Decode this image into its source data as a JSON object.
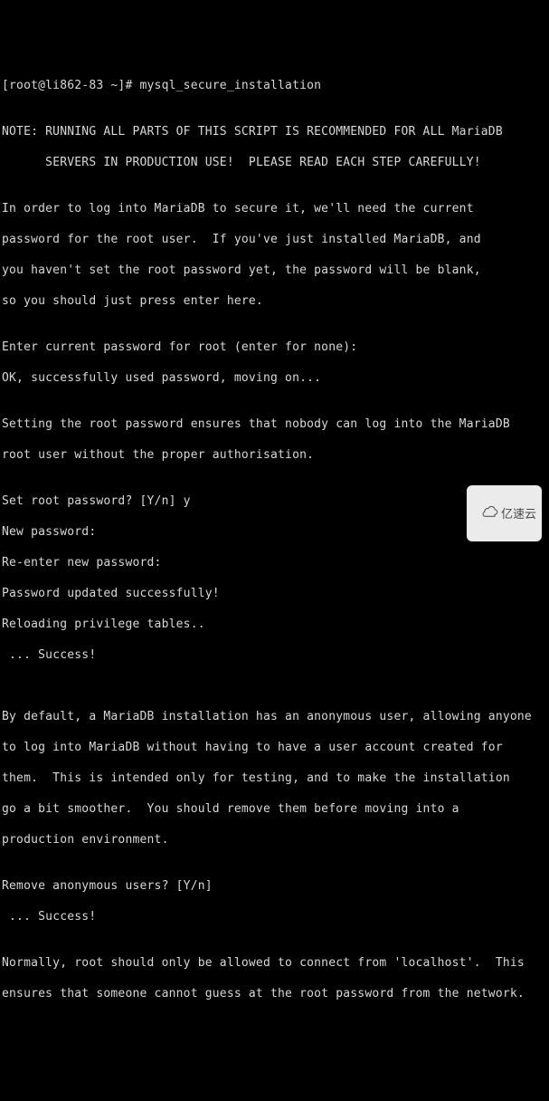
{
  "terminal": {
    "prompt_line": "[root@li862-83 ~]# mysql_secure_installation",
    "blank1": "",
    "note1": "NOTE: RUNNING ALL PARTS OF THIS SCRIPT IS RECOMMENDED FOR ALL MariaDB",
    "note2": "      SERVERS IN PRODUCTION USE!  PLEASE READ EACH STEP CAREFULLY!",
    "blank2": "",
    "intro1": "In order to log into MariaDB to secure it, we'll need the current",
    "intro2": "password for the root user.  If you've just installed MariaDB, and",
    "intro3": "you haven't set the root password yet, the password will be blank,",
    "intro4": "so you should just press enter here.",
    "blank3": "",
    "enter_pw": "Enter current password for root (enter for none):",
    "ok_pw": "OK, successfully used password, moving on...",
    "blank4": "",
    "set1": "Setting the root password ensures that nobody can log into the MariaDB",
    "set2": "root user without the proper authorisation.",
    "blank5": "",
    "set_prompt": "Set root password? [Y/n] y",
    "new_pw": "New password:",
    "reenter_pw": "Re-enter new password:",
    "pw_updated": "Password updated successfully!",
    "reload_priv": "Reloading privilege tables..",
    "success1": " ... Success!",
    "blank6": "",
    "blank7": "",
    "anon1": "By default, a MariaDB installation has an anonymous user, allowing anyone",
    "anon2": "to log into MariaDB without having to have a user account created for",
    "anon3": "them.  This is intended only for testing, and to make the installation",
    "anon4": "go a bit smoother.  You should remove them before moving into a",
    "anon5": "production environment.",
    "blank8": "",
    "remove_prompt": "Remove anonymous users? [Y/n]",
    "success2": " ... Success!",
    "blank9": "",
    "local1": "Normally, root should only be allowed to connect from 'localhost'.  This",
    "local2": "ensures that someone cannot guess at the root password from the network."
  },
  "watermark": {
    "text": "亿速云"
  }
}
